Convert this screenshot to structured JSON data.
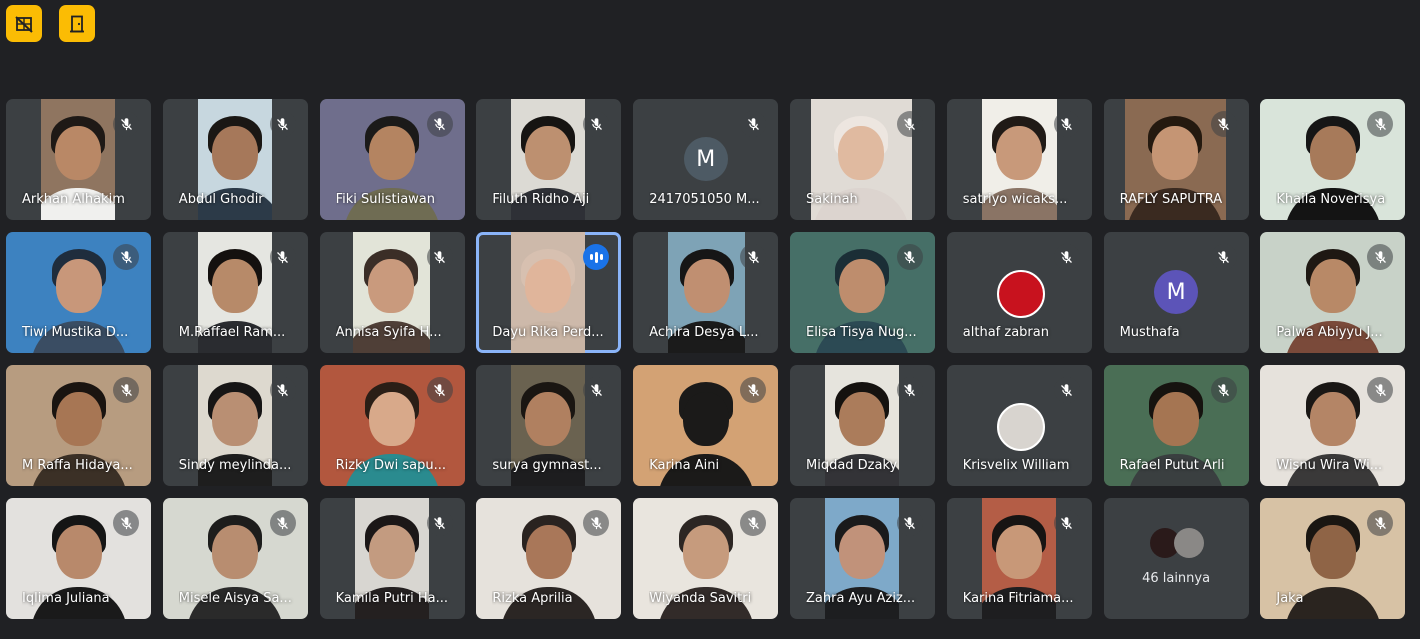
{
  "toolbar": {
    "buttons": [
      {
        "name": "no-video-icon",
        "label": ""
      },
      {
        "name": "exit-door-icon",
        "label": ""
      }
    ],
    "accent": "#fbbc04"
  },
  "participants": [
    {
      "name": "Arkhan Alhakim",
      "type": "video",
      "vl": 35,
      "vw": 74,
      "bg": "#8f7560",
      "skin": "#b98866",
      "hair": "#1e1916",
      "shirt": "#f0f0ee",
      "muted": true
    },
    {
      "name": "Abdul Ghodir",
      "type": "video",
      "vl": 35,
      "vw": 74,
      "bg": "#c7d7df",
      "skin": "#a6785a",
      "hair": "#1a1714",
      "shirt": "#2c3a48",
      "muted": true
    },
    {
      "name": "Fiki Sulistiawan",
      "type": "video",
      "vl": 0,
      "vw": 145,
      "bg": "#6f6e8c",
      "skin": "#b48461",
      "hair": "#1b1a19",
      "shirt": "#6f6c53",
      "muted": true
    },
    {
      "name": "Filuth Ridho Aji",
      "type": "video",
      "vl": 35,
      "vw": 74,
      "bg": "#dcdad4",
      "skin": "#bd9070",
      "hair": "#161412",
      "shirt": "#2e3036",
      "muted": true
    },
    {
      "name": "2417051050 M...",
      "type": "avatar",
      "letter": "M",
      "avatar_color": "#4d5a64",
      "muted": true
    },
    {
      "name": "Sakinah",
      "type": "video",
      "vl": 21,
      "vw": 101,
      "bg": "#e0dbd5",
      "skin": "#e0baa0",
      "hair": "#ede6e0",
      "shirt": "#dcd4cf",
      "muted": true
    },
    {
      "name": "satriyo wicaks...",
      "type": "video",
      "vl": 35,
      "vw": 75,
      "bg": "#f0eee8",
      "skin": "#c8997a",
      "hair": "#201a16",
      "shirt": "#8a7465",
      "muted": true
    },
    {
      "name": "RAFLY SAPUTRA",
      "type": "video",
      "vl": 21,
      "vw": 101,
      "bg": "#8a6a52",
      "skin": "#c59574",
      "hair": "#24190f",
      "shirt": "#3a2a20",
      "muted": true
    },
    {
      "name": "Khaila Noverisya",
      "type": "video",
      "vl": 0,
      "vw": 145,
      "bg": "#d9e4da",
      "skin": "#a77a5a",
      "hair": "#161616",
      "shirt": "#141414",
      "muted": true
    },
    {
      "name": "Tiwi Mustika D...",
      "type": "video",
      "vl": 0,
      "vw": 145,
      "bg": "#3d82c0",
      "skin": "#c8977a",
      "hair": "#1f2d3d",
      "shirt": "#3a4d63",
      "muted": true
    },
    {
      "name": "M.Raffael Ram...",
      "type": "video",
      "vl": 35,
      "vw": 74,
      "bg": "#e5e6e1",
      "skin": "#b78a69",
      "hair": "#14110f",
      "shirt": "#2a2c30",
      "muted": true
    },
    {
      "name": "Annisa Syifa H...",
      "type": "video",
      "vl": 33,
      "vw": 77,
      "bg": "#e2e4d8",
      "skin": "#c99a7d",
      "hair": "#3b2e27",
      "shirt": "#4f3f37",
      "muted": true
    },
    {
      "name": "Dayu Rika Perd...",
      "type": "video",
      "vl": 35,
      "vw": 74,
      "bg": "#cdb9aa",
      "skin": "#e0b59b",
      "hair": "#d7c0b0",
      "shirt": "#c9b5a5",
      "muted": false,
      "speaking": true
    },
    {
      "name": "Achira Desya L...",
      "type": "video",
      "vl": 35,
      "vw": 77,
      "bg": "#7ea3b6",
      "skin": "#c08f71",
      "hair": "#161616",
      "shirt": "#1b1b1b",
      "muted": true
    },
    {
      "name": "Elisa Tisya Nug...",
      "type": "video",
      "vl": 0,
      "vw": 145,
      "bg": "#466f67",
      "skin": "#be8d6d",
      "hair": "#1b2e36",
      "shirt": "#2c4a54",
      "muted": true
    },
    {
      "name": "althaf zabran",
      "type": "avatar",
      "letter": "",
      "avatar_color": "#c8121e",
      "muted": true
    },
    {
      "name": "Musthafa",
      "type": "avatar",
      "letter": "M",
      "avatar_color": "#5c54b8",
      "muted": true
    },
    {
      "name": "Palwa Abiyyu J...",
      "type": "video",
      "vl": 0,
      "vw": 145,
      "bg": "#c8d2c8",
      "skin": "#b88967",
      "hair": "#1e1813",
      "shirt": "#7a4a3a",
      "muted": true
    },
    {
      "name": "M Raffa Hidaya...",
      "type": "video",
      "vl": 0,
      "vw": 145,
      "bg": "#b79c80",
      "skin": "#a77654",
      "hair": "#1a1410",
      "shirt": "#3b3026",
      "muted": true
    },
    {
      "name": "Sindy meylinda...",
      "type": "video",
      "vl": 35,
      "vw": 74,
      "bg": "#ddd9cf",
      "skin": "#b98f73",
      "hair": "#161515",
      "shirt": "#1e1e1e",
      "muted": true
    },
    {
      "name": "Rizky Dwi sapu...",
      "type": "video",
      "vl": 0,
      "vw": 145,
      "bg": "#b2573e",
      "skin": "#d8a98a",
      "hair": "#2a1e16",
      "shirt": "#2a8b8f",
      "muted": true
    },
    {
      "name": "surya gymnast...",
      "type": "video",
      "vl": 35,
      "vw": 74,
      "bg": "#6a6250",
      "skin": "#b08060",
      "hair": "#1a1612",
      "shirt": "#1d1d1f",
      "muted": true
    },
    {
      "name": "Karina Aini",
      "type": "video",
      "vl": 0,
      "vw": 145,
      "bg": "#d3a274",
      "skin": "#1b1a19",
      "hair": "#1b1a19",
      "shirt": "#1b1a19",
      "muted": true
    },
    {
      "name": "Miqdad Dzaky",
      "type": "video",
      "vl": 35,
      "vw": 74,
      "bg": "#e6e4dd",
      "skin": "#ab7c5b",
      "hair": "#15120f",
      "shirt": "#333337",
      "muted": true
    },
    {
      "name": "Krisvelix William",
      "type": "avatar",
      "letter": "",
      "avatar_color": "#d8d4cf",
      "muted": true
    },
    {
      "name": "Rafael Putut Arli",
      "type": "video",
      "vl": 0,
      "vw": 145,
      "bg": "#4a6e55",
      "skin": "#a57552",
      "hair": "#16130f",
      "shirt": "#3a3f40",
      "muted": true
    },
    {
      "name": "Wisnu Wira Wi...",
      "type": "video",
      "vl": 0,
      "vw": 145,
      "bg": "#e6e2dc",
      "skin": "#b48566",
      "hair": "#1a1715",
      "shirt": "#3a3939",
      "muted": true
    },
    {
      "name": "Iqlima Juliana",
      "type": "video",
      "vl": 0,
      "vw": 145,
      "bg": "#e3e1de",
      "skin": "#b8896b",
      "hair": "#151515",
      "shirt": "#1a1a1a",
      "muted": true
    },
    {
      "name": "Misele Aisya Sa...",
      "type": "video",
      "vl": 0,
      "vw": 145,
      "bg": "#d6d8d0",
      "skin": "#b88d70",
      "hair": "#1d1d1c",
      "shirt": "#2a2a2a",
      "muted": true
    },
    {
      "name": "Kamila Putri Ha...",
      "type": "video",
      "vl": 35,
      "vw": 74,
      "bg": "#d8d6d1",
      "skin": "#c39b80",
      "hair": "#1b1717",
      "shirt": "#242020",
      "muted": true
    },
    {
      "name": "Rizka Aprilia",
      "type": "video",
      "vl": 0,
      "vw": 145,
      "bg": "#e6e2dc",
      "skin": "#a97759",
      "hair": "#2a2320",
      "shirt": "#2b2624",
      "muted": true
    },
    {
      "name": "Wiyanda Savitri",
      "type": "video",
      "vl": 0,
      "vw": 145,
      "bg": "#e9e5de",
      "skin": "#c69b7d",
      "hair": "#2c2623",
      "shirt": "#322b29",
      "muted": true
    },
    {
      "name": "Zahra Ayu Aziz...",
      "type": "video",
      "vl": 35,
      "vw": 74,
      "bg": "#7ea9c9",
      "skin": "#c1927a",
      "hair": "#1a1a1b",
      "shirt": "#1d1e20",
      "muted": true
    },
    {
      "name": "Karina Fitriama...",
      "type": "video",
      "vl": 35,
      "vw": 74,
      "bg": "#b45d46",
      "skin": "#c89878",
      "hair": "#171413",
      "shirt": "#1e1e20",
      "muted": true
    },
    {
      "name": "46 lainnya",
      "type": "others",
      "muted": false
    },
    {
      "name": "Jaka",
      "type": "video",
      "vl": 0,
      "vw": 145,
      "bg": "#d7c2a5",
      "skin": "#8f6446",
      "hair": "#1a1612",
      "shirt": "#2a241f",
      "muted": true
    }
  ]
}
